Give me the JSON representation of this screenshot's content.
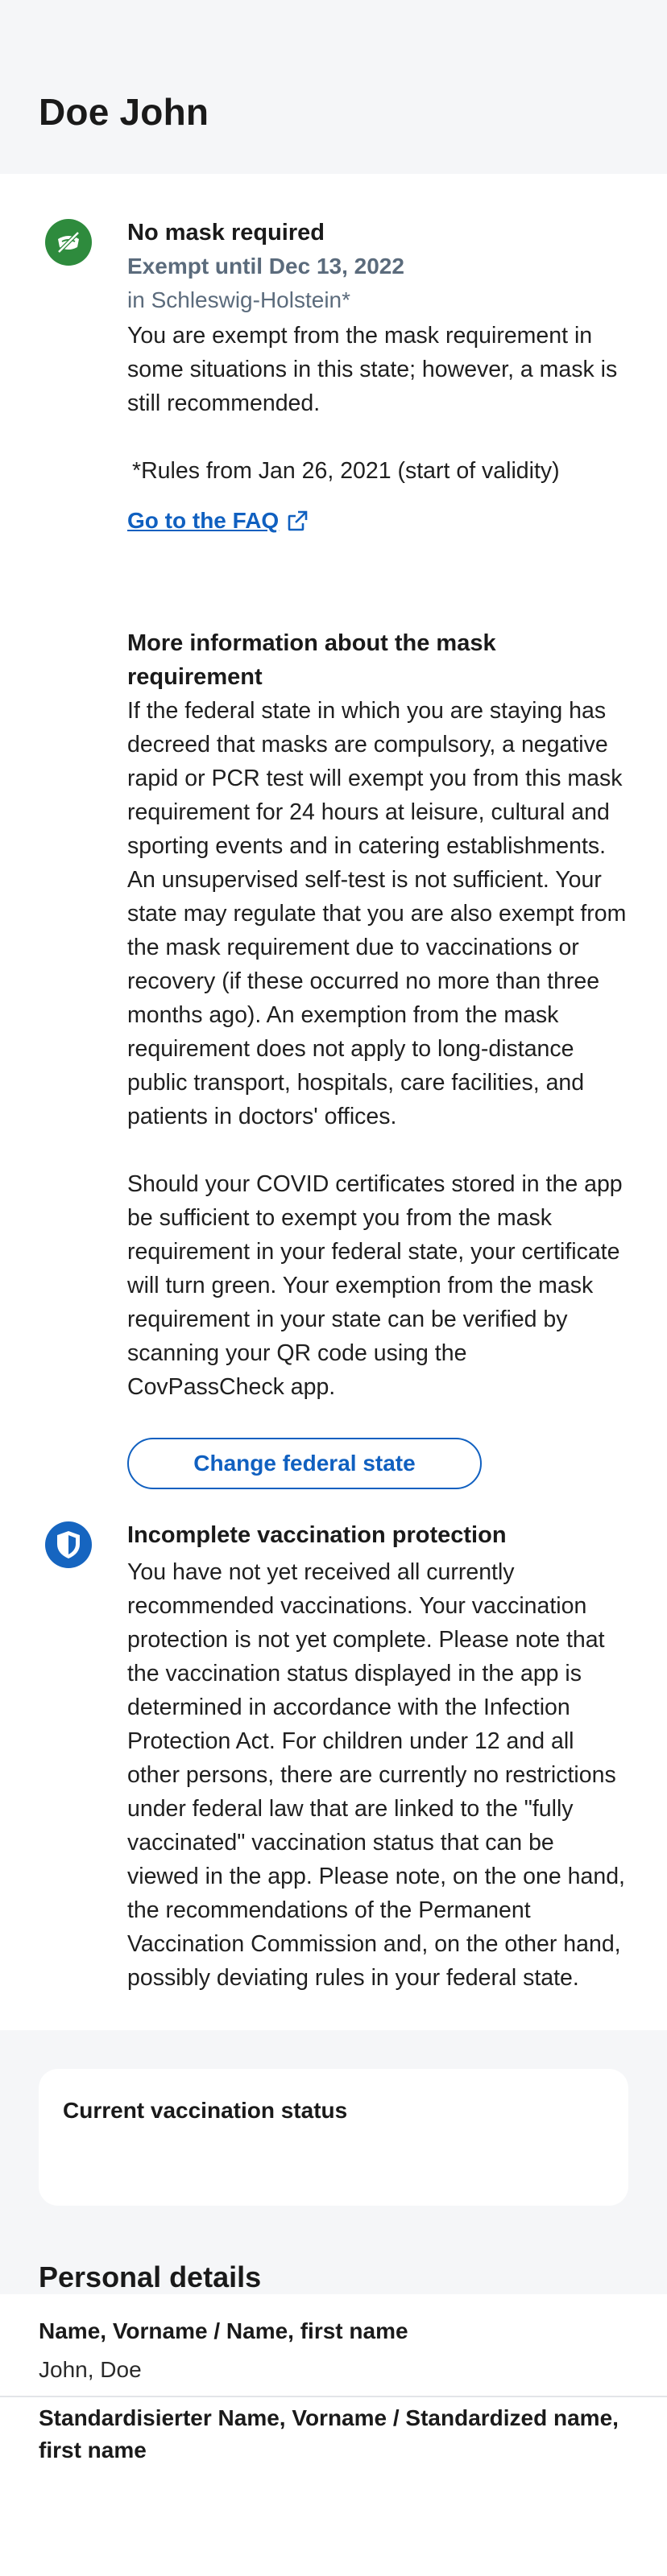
{
  "header": {
    "name": "Doe John"
  },
  "mask": {
    "title": "No mask required",
    "exempt_until": "Exempt until Dec 13, 2022",
    "state": "in Schleswig-Holstein*",
    "description": "You are exempt from the mask requirement in some situations in this state; however, a mask is still recommended.",
    "rules_note": "*Rules from Jan 26, 2021 (start of validity)",
    "faq_link": "Go to the FAQ",
    "more_info_title": "More information about the mask requirement",
    "more_info_p1": "If the federal state in which you are staying has decreed that masks are compulsory, a negative rapid or PCR test will exempt you from this mask requirement for 24 hours at leisure, cultural and sporting events and in catering establishments. An unsupervised self-test is not sufficient. Your state may regulate that you are also exempt from the mask requirement due to vaccinations or recovery (if these occurred no more than three months ago). An exemption from the mask requirement does not apply to long-distance public transport, hospitals, care facilities, and patients in doctors' offices.",
    "more_info_p2": "Should your COVID certificates stored in the app be sufficient to exempt you from the mask requirement in your federal state, your certificate will turn green. Your exemption from the mask requirement in your state can be verified by scanning your QR code using the CovPassCheck app.",
    "change_state_button": "Change federal state"
  },
  "vaccination": {
    "title": "Incomplete vaccination protection",
    "description": "You have not yet received all currently recommended vaccinations. Your vaccination protection is not yet complete. Please note that the vaccination status displayed in the app is determined in accordance with the Infection Protection Act. For children under 12 and all other persons, there are currently no restrictions under federal law that are linked to the \"fully vaccinated\" vaccination status that can be viewed in the app. Please note, on the one hand, the recommendations of the Permanent Vaccination Commission and, on the other hand, possibly deviating rules in your federal state."
  },
  "status_card": {
    "label": "Current vaccination status"
  },
  "personal": {
    "title": "Personal details",
    "fields": [
      {
        "label": "Name, Vorname / Name, first name",
        "value": "John, Doe"
      },
      {
        "label": "Standardisierter Name, Vorname / Standardized name, first name"
      }
    ]
  },
  "colors": {
    "accent_blue": "#1060c0",
    "mask_icon_green": "#2e8b3d",
    "shield_icon_blue": "#1665c0",
    "secondary_grey": "#5b6b7c",
    "band_grey": "#f5f6f8"
  },
  "icons": {
    "mask": "mask-crossed-icon",
    "shield": "shield-icon",
    "external": "external-link-icon"
  }
}
